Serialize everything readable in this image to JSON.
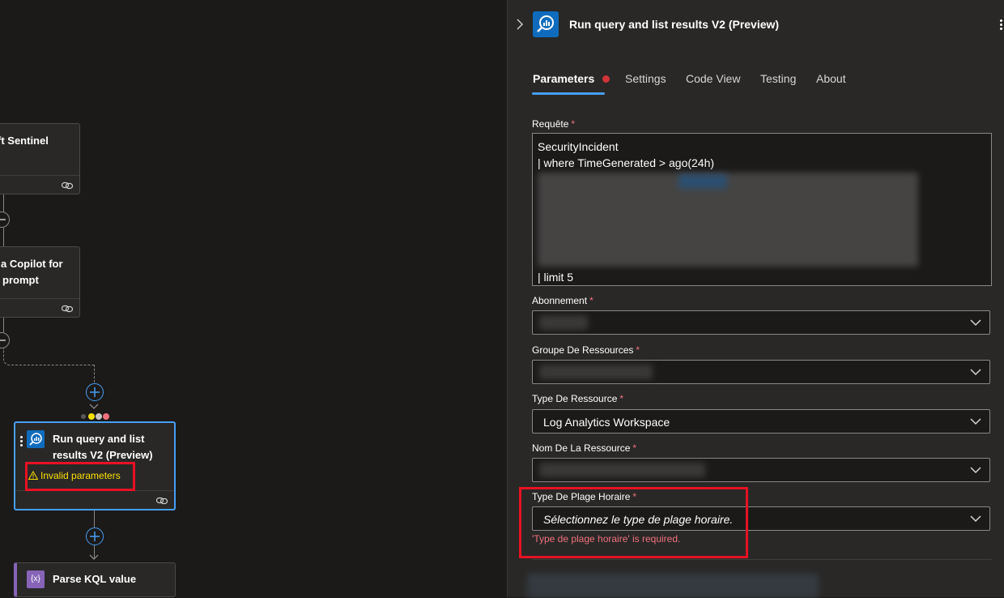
{
  "canvas": {
    "card_sentinel_title": "ft Sentinel",
    "card_copilot_title_line1": "a Copilot for",
    "card_copilot_title_line2": "prompt",
    "card_run_query_title_line1": "Run query and list",
    "card_run_query_title_line2": "results V2 (Preview)",
    "card_run_query_warning": "Invalid parameters",
    "card_parse_title": "Parse KQL value",
    "parse_icon_text": "{x}"
  },
  "panel": {
    "title": "Run query and list results V2 (Preview)",
    "tabs": [
      {
        "label": "Parameters"
      },
      {
        "label": "Settings"
      },
      {
        "label": "Code View"
      },
      {
        "label": "Testing"
      },
      {
        "label": "About"
      }
    ],
    "query": {
      "label": "Requête",
      "line1": "SecurityIncident",
      "line2": "| where TimeGenerated > ago(24h)",
      "last_line": "| limit 5"
    },
    "subscription": {
      "label": "Abonnement"
    },
    "resource_group": {
      "label": "Groupe De Ressources"
    },
    "resource_type": {
      "label": "Type De Ressource",
      "value": "Log Analytics Workspace"
    },
    "resource_name": {
      "label": "Nom De La Ressource"
    },
    "time_range_type": {
      "label": "Type De Plage Horaire",
      "placeholder": "Sélectionnez le type de plage horaire.",
      "error": "'Type de plage horaire' is required."
    },
    "required_marker": "*"
  },
  "colors": {
    "accent_blue": "#479ef5",
    "error_red": "#e81123",
    "warning_yellow": "#fce100",
    "required_pink": "#f1707b"
  }
}
